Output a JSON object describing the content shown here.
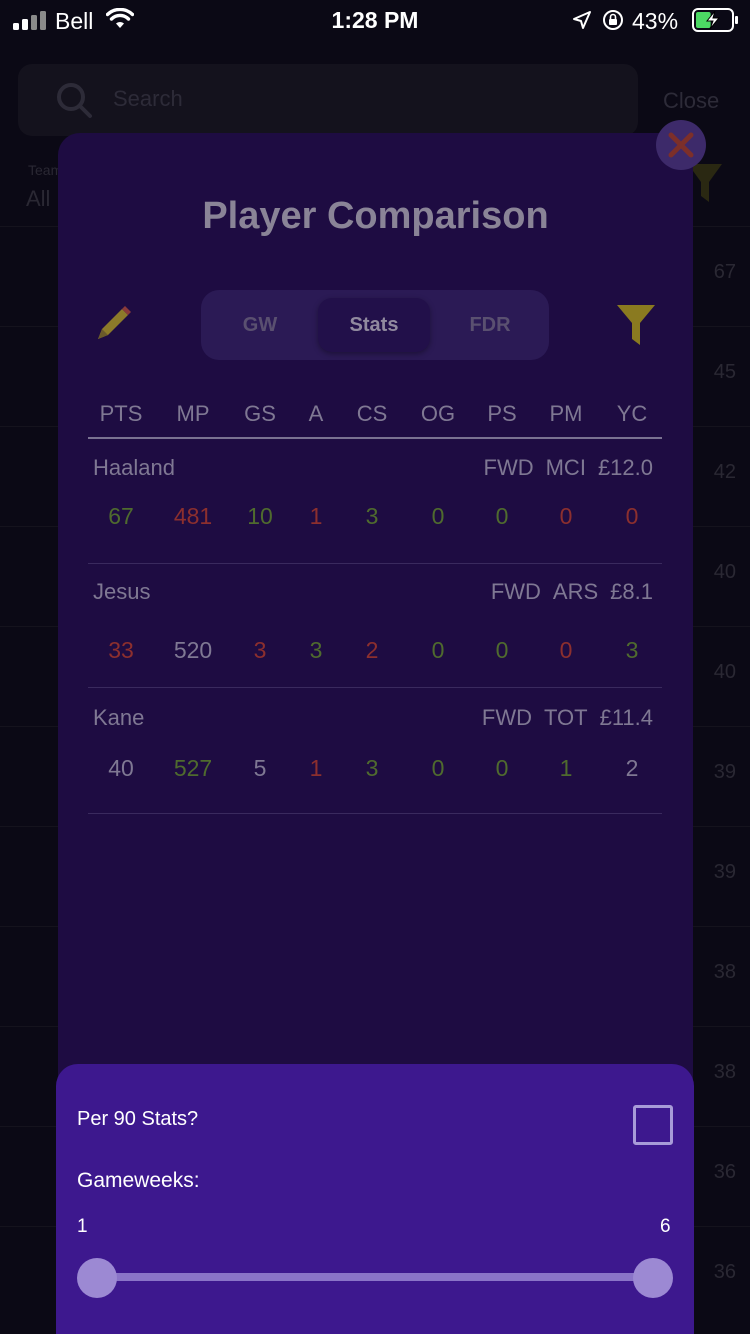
{
  "status_bar": {
    "carrier": "Bell",
    "time": "1:28 PM",
    "battery_percent": "43%",
    "battery_level": 0.43,
    "icons": [
      "signal-icon",
      "wifi-icon",
      "location-icon",
      "orientation-lock-icon",
      "battery-charging-icon"
    ]
  },
  "background": {
    "search_placeholder": "Search",
    "close_label": "Close",
    "team_label": "Team",
    "team_value": "All",
    "row_values": [
      "67",
      "45",
      "42",
      "40",
      "40",
      "39",
      "39",
      "38",
      "38",
      "36",
      "36"
    ]
  },
  "modal": {
    "title": "Player Comparison",
    "tabs": [
      {
        "label": "GW",
        "active": false
      },
      {
        "label": "Stats",
        "active": true
      },
      {
        "label": "FDR",
        "active": false
      }
    ],
    "columns": [
      "PTS",
      "MP",
      "GS",
      "A",
      "CS",
      "OG",
      "PS",
      "PM",
      "YC"
    ],
    "players": [
      {
        "name": "Haaland",
        "position": "FWD",
        "team": "MCI",
        "price": "£12.0",
        "stats": [
          {
            "v": "67",
            "c": "green"
          },
          {
            "v": "481",
            "c": "red"
          },
          {
            "v": "10",
            "c": "green"
          },
          {
            "v": "1",
            "c": "red"
          },
          {
            "v": "3",
            "c": "green"
          },
          {
            "v": "0",
            "c": "green"
          },
          {
            "v": "0",
            "c": "green"
          },
          {
            "v": "0",
            "c": "red"
          },
          {
            "v": "0",
            "c": "red"
          }
        ]
      },
      {
        "name": "Jesus",
        "position": "FWD",
        "team": "ARS",
        "price": "£8.1",
        "stats": [
          {
            "v": "33",
            "c": "red"
          },
          {
            "v": "520",
            "c": "grey"
          },
          {
            "v": "3",
            "c": "red"
          },
          {
            "v": "3",
            "c": "green"
          },
          {
            "v": "2",
            "c": "red"
          },
          {
            "v": "0",
            "c": "green"
          },
          {
            "v": "0",
            "c": "green"
          },
          {
            "v": "0",
            "c": "red"
          },
          {
            "v": "3",
            "c": "green"
          }
        ]
      },
      {
        "name": "Kane",
        "position": "FWD",
        "team": "TOT",
        "price": "£11.4",
        "stats": [
          {
            "v": "40",
            "c": "grey"
          },
          {
            "v": "527",
            "c": "green"
          },
          {
            "v": "5",
            "c": "grey"
          },
          {
            "v": "1",
            "c": "red"
          },
          {
            "v": "3",
            "c": "green"
          },
          {
            "v": "0",
            "c": "green"
          },
          {
            "v": "0",
            "c": "green"
          },
          {
            "v": "1",
            "c": "green"
          },
          {
            "v": "2",
            "c": "grey"
          }
        ]
      }
    ]
  },
  "filters": {
    "per90_label": "Per 90 Stats?",
    "per90_checked": false,
    "gameweeks_label": "Gameweeks:",
    "range_min": "1",
    "range_max": "6"
  },
  "colors": {
    "modal_bg": "#1e0c42",
    "sheet_bg": "#3d188e",
    "good": "#4f6b2e",
    "bad": "#8c2f2e",
    "neutral": "#7f7893"
  }
}
